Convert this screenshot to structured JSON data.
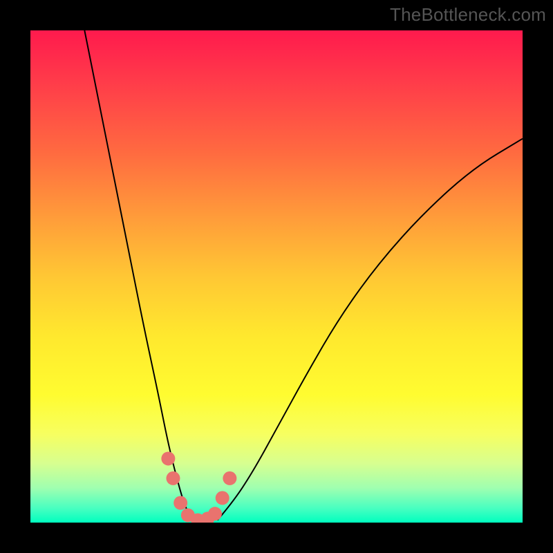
{
  "watermark": "TheBottleneck.com",
  "chart_data": {
    "type": "line",
    "title": "",
    "xlabel": "",
    "ylabel": "",
    "xlim": [
      0,
      100
    ],
    "ylim": [
      0,
      100
    ],
    "grid": false,
    "legend": false,
    "background_gradient": {
      "top_color": "#ff1a4d",
      "bottom_color": "#00ffbf",
      "description": "vertical red→orange→yellow→green heat gradient"
    },
    "series": [
      {
        "name": "left-curve",
        "color": "#000000",
        "stroke_width": 2,
        "x": [
          11,
          14,
          17,
          20,
          23,
          26,
          28,
          30,
          31.5,
          33
        ],
        "y": [
          100,
          85,
          70,
          55,
          40,
          26,
          16,
          8,
          3,
          0.5
        ]
      },
      {
        "name": "right-curve",
        "color": "#000000",
        "stroke_width": 2,
        "x": [
          38,
          41,
          45,
          50,
          56,
          63,
          71,
          80,
          90,
          100
        ],
        "y": [
          0.5,
          4,
          10,
          19,
          30,
          42,
          53,
          63,
          72,
          78
        ]
      },
      {
        "name": "trough-markers",
        "color": "#e9736e",
        "type": "scatter",
        "marker_radius_px": 10,
        "x": [
          28,
          29,
          30.5,
          32,
          34,
          36,
          37.5,
          39,
          40.5
        ],
        "y": [
          13,
          9,
          4,
          1.5,
          0.5,
          0.8,
          1.8,
          5,
          9
        ]
      }
    ],
    "annotations": []
  }
}
